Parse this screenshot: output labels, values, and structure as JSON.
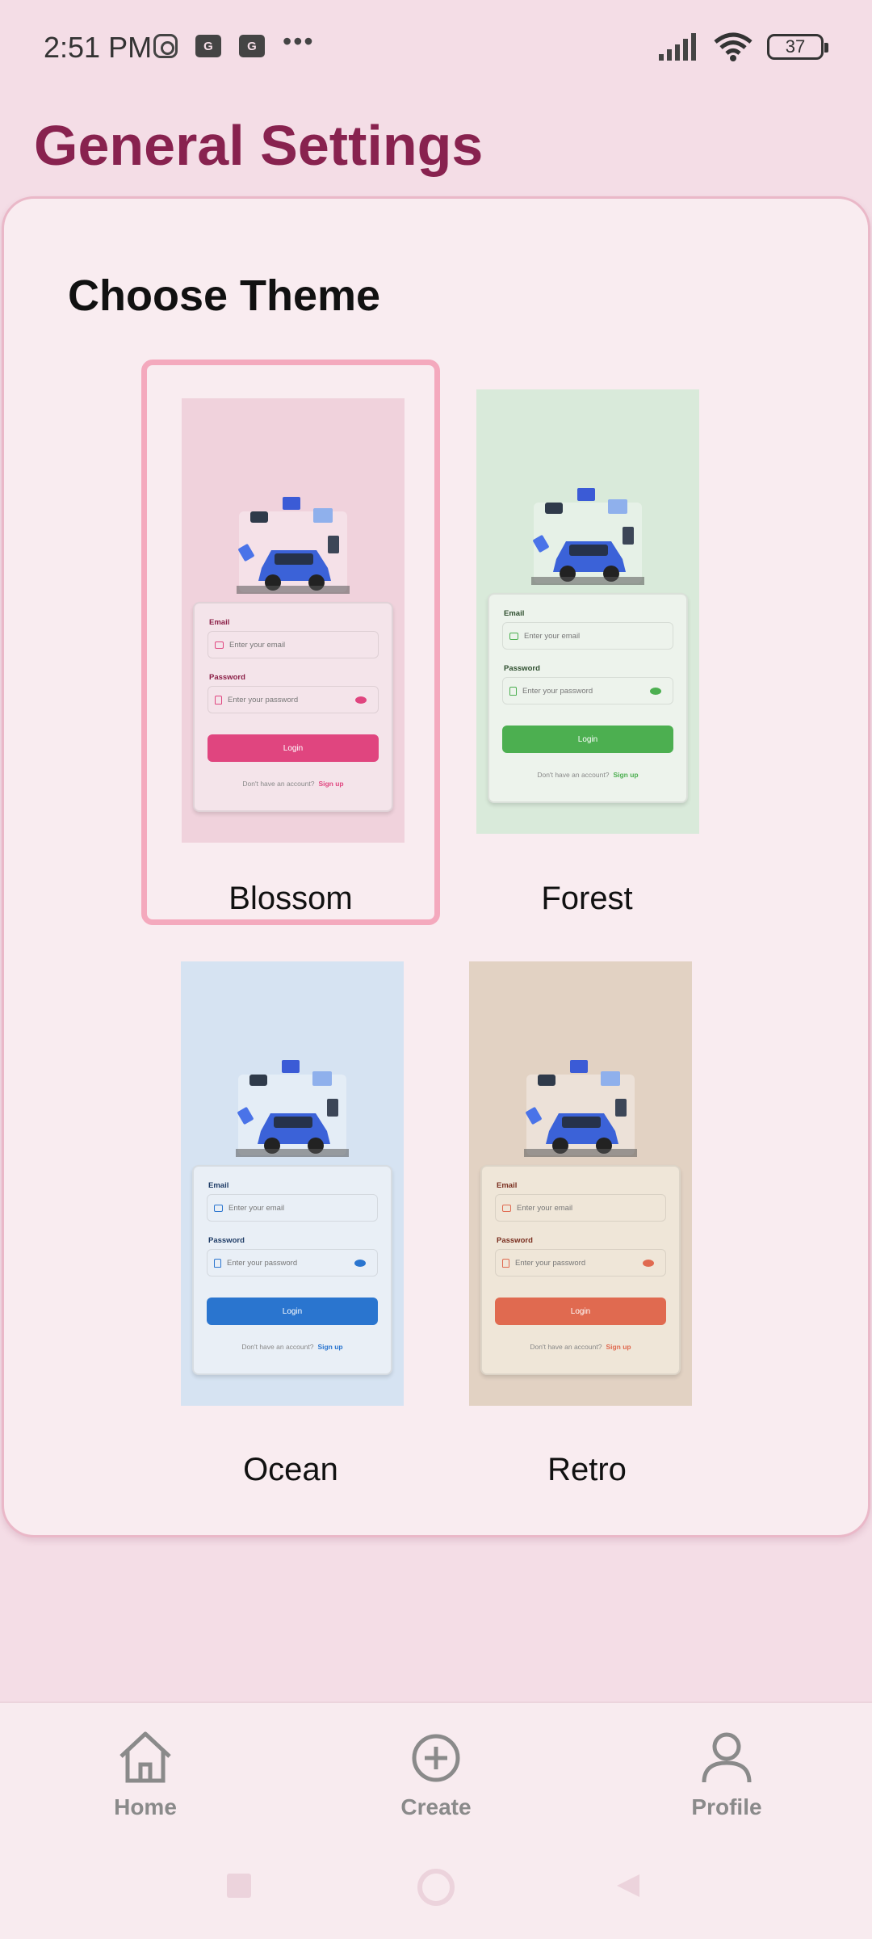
{
  "status_bar": {
    "time": "2:51 PM",
    "notif_icons": [
      "instagram-icon",
      "news-icon",
      "news-icon"
    ],
    "more": "•••",
    "battery": "37"
  },
  "page": {
    "title": "General Settings"
  },
  "theme_section": {
    "title": "Choose Theme",
    "selected": "Blossom",
    "themes": [
      {
        "name": "Blossom",
        "bg": "#f0d2dc",
        "card": "#f4e4ea",
        "accent": "#e0457f",
        "label": "#8b1f47"
      },
      {
        "name": "Forest",
        "bg": "#d9eada",
        "card": "#edf3ec",
        "accent": "#4caf50",
        "label": "#2e4e2e"
      },
      {
        "name": "Ocean",
        "bg": "#d6e3f2",
        "card": "#e9eff6",
        "accent": "#2a75cf",
        "label": "#1f3c66"
      },
      {
        "name": "Retro",
        "bg": "#e2d2c3",
        "card": "#efe6d8",
        "accent": "#e06a50",
        "label": "#7a2f20"
      }
    ],
    "preview": {
      "email_label": "Email",
      "email_placeholder": "Enter your email",
      "password_label": "Password",
      "password_placeholder": "Enter your password",
      "login_button": "Login",
      "footer_text": "Don't have an account?",
      "footer_link": "Sign up"
    }
  },
  "bottom_nav": {
    "items": [
      {
        "label": "Home",
        "icon": "home-icon"
      },
      {
        "label": "Create",
        "icon": "plus-circle-icon"
      },
      {
        "label": "Profile",
        "icon": "person-icon"
      }
    ]
  },
  "system_nav": [
    "square-icon",
    "circle-icon",
    "back-triangle-icon"
  ]
}
